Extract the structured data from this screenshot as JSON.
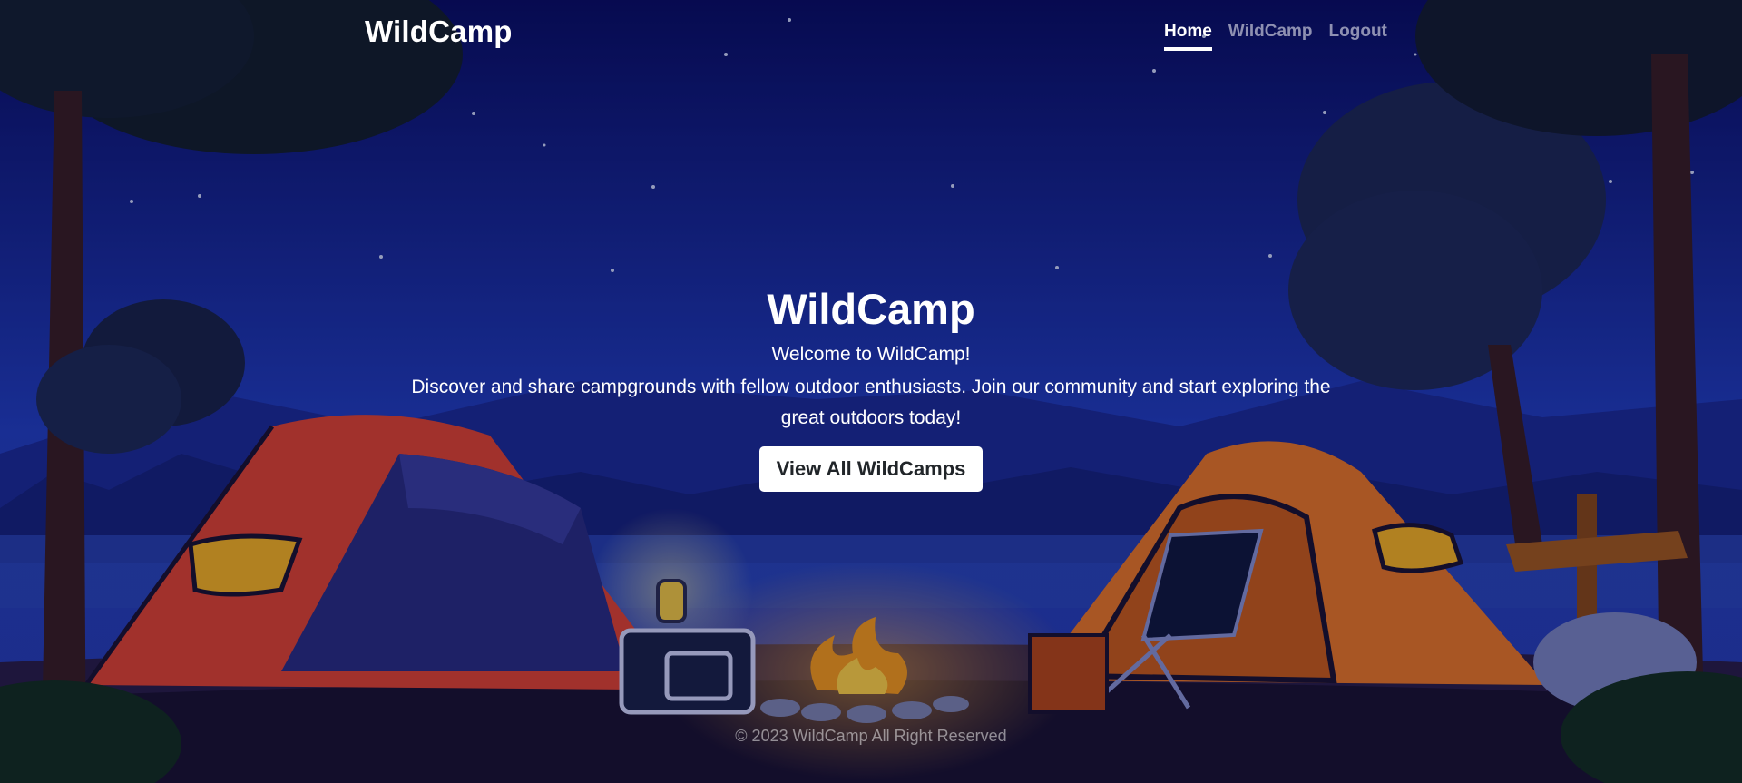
{
  "nav": {
    "brand": "WildCamp",
    "links": [
      {
        "label": "Home",
        "active": true
      },
      {
        "label": "WildCamp",
        "active": false
      },
      {
        "label": "Logout",
        "active": false
      }
    ]
  },
  "hero": {
    "title": "WildCamp",
    "welcome": "Welcome to WildCamp!",
    "description": "Discover and share campgrounds with fellow outdoor enthusiasts. Join our community and start exploring the great outdoors today!",
    "cta_label": "View All WildCamps"
  },
  "footer": {
    "text": "© 2023 WildCamp All Right Reserved"
  },
  "colors": {
    "sky_top": "#0a0f6b",
    "sky_bottom": "#2340c8",
    "tent_left": "#e0453a",
    "tent_right": "#e9782e"
  }
}
